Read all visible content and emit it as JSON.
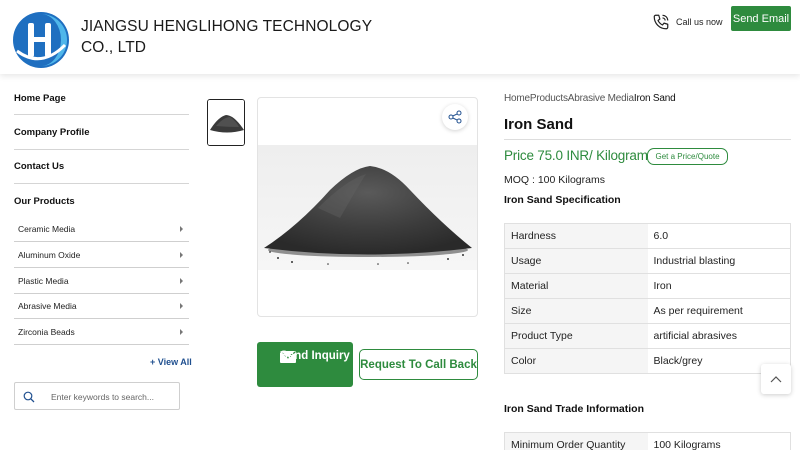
{
  "header": {
    "company_name": "JIANGSU HENGLIHONG TECHNOLOGY CO., LTD",
    "call_label": "Call us now",
    "send_email_label": "Send Email",
    "brand_color": "#2e8b3e"
  },
  "sidebar": {
    "home": "Home Page",
    "profile": "Company Profile",
    "contact": "Contact Us",
    "products_heading": "Our Products",
    "categories": [
      {
        "label": "Ceramic Media"
      },
      {
        "label": "Aluminum Oxide"
      },
      {
        "label": "Plastic Media"
      },
      {
        "label": "Abrasive Media"
      },
      {
        "label": "Zirconia Beads"
      }
    ],
    "view_all": "+ View All",
    "search_placeholder": "Enter keywords to search..."
  },
  "gallery": {
    "inquiry_label": "Send Inquiry",
    "callback_label": "Request To Call Back"
  },
  "product": {
    "breadcrumb": [
      "Home",
      "Products",
      "Abrasive Media",
      "Iron Sand"
    ],
    "title": "Iron Sand",
    "price": "Price 75.0 INR/ Kilograms",
    "quote_label": "Get a Price/Quote",
    "moq": "MOQ : 100 Kilograms",
    "spec_heading": "Iron Sand Specification",
    "specs": [
      {
        "key": "Hardness",
        "value": "6.0"
      },
      {
        "key": "Usage",
        "value": "Industrial blasting"
      },
      {
        "key": "Material",
        "value": "Iron"
      },
      {
        "key": "Size",
        "value": "As per requirement"
      },
      {
        "key": "Product Type",
        "value": "artificial abrasives"
      },
      {
        "key": "Color",
        "value": "Black/grey"
      }
    ],
    "trade_heading": "Iron Sand Trade Information",
    "trade": [
      {
        "key": "Minimum Order Quantity",
        "value": "100 Kilograms"
      }
    ]
  }
}
